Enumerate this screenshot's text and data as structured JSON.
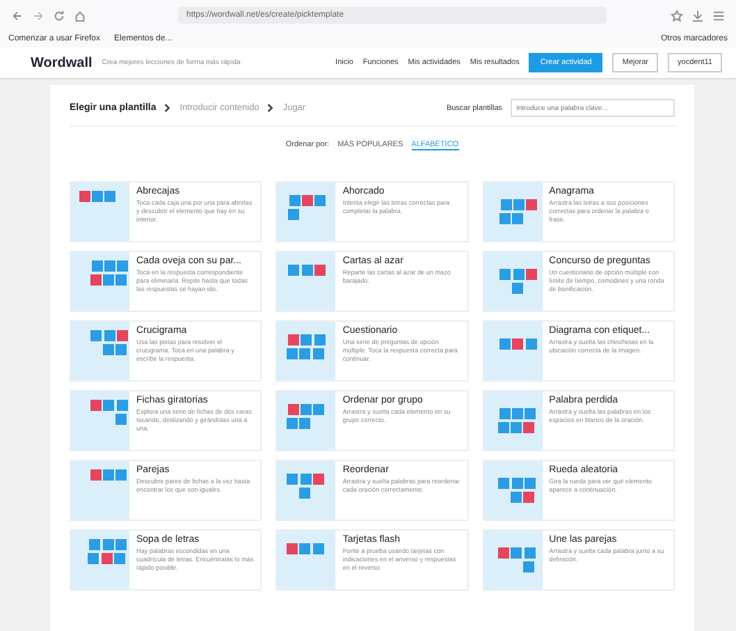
{
  "browser": {
    "address": "https://wordwall.net/es/create/picktemplate",
    "bookmarks": [
      "Comenzar a usar Firefox",
      "Elementos de..."
    ],
    "other_bookmarks": "Otros marcadores"
  },
  "header": {
    "logo": "Wordwall",
    "tagline": "Crea mejores lecciones de forma más rápida",
    "nav": [
      {
        "label": "Inicio"
      },
      {
        "label": "Funciones"
      },
      {
        "label": "Mis actividades"
      },
      {
        "label": "Mis resultados"
      }
    ],
    "create": "Crear actividad",
    "upgrade": "Mejorar",
    "user": "yocdent11"
  },
  "steps": [
    {
      "label": "Elegir una plantilla",
      "selected": true
    },
    {
      "label": "Introducir contenido",
      "selected": false
    },
    {
      "label": "Jugar",
      "selected": false
    }
  ],
  "search": {
    "label": "Buscar plantillas",
    "placeholder": "Introduce una palabra clave..."
  },
  "sort": {
    "label": "Ordenar por:",
    "options": [
      {
        "label": "MÁS POPULARES",
        "selected": false
      },
      {
        "label": "ALFABÉTICO",
        "selected": true
      }
    ]
  },
  "templates": [
    {
      "title": "Abrecajas",
      "description": "Toca cada caja una por una para abrirlas y descubrir el elemento que hay en su interior."
    },
    {
      "title": "Ahorcado",
      "description": "Intenta elegir las letras correctas para completar la palabra."
    },
    {
      "title": "Anagrama",
      "description": "Arrastra las letras a sus posiciones correctas para ordenar la palabra o frase."
    },
    {
      "title": "Cada oveja con su par...",
      "description": "Toca en la respuesta correspondiente para eliminarla. Repite hasta que todas las respuestas se hayan ido."
    },
    {
      "title": "Cartas al azar",
      "description": "Reparte las cartas al azar de un mazo barajado."
    },
    {
      "title": "Concurso de preguntas",
      "description": "Un cuestionario de opción múltiple con límite de tiempo, comodines y una ronda de bonificación."
    },
    {
      "title": "Crucigrama",
      "description": "Usa las pistas para resolver el crucigrama. Toca en una palabra y escribe la respuesta."
    },
    {
      "title": "Cuestionario",
      "description": "Una serie de preguntas de opción múltiple. Toca la respuesta correcta para continuar."
    },
    {
      "title": "Diagrama con etiquet...",
      "description": "Arrastra y suelta las chinchetas en la ubicación correcta de la imagen."
    },
    {
      "title": "Fichas giratorias",
      "description": "Explora una serie de fichas de dos caras tocando, deslizando y girándolas una a una."
    },
    {
      "title": "Ordenar por grupo",
      "description": "Arrastra y suelta cada elemento en su grupo correcto."
    },
    {
      "title": "Palabra perdida",
      "description": "Arrastra y suelta las palabras en los espacios en blanco de la oración."
    },
    {
      "title": "Parejas",
      "description": "Descubre pares de fichas a la vez hasta encontrar los que son iguales."
    },
    {
      "title": "Reordenar",
      "description": "Arrastra y suelta palabras para reordenar cada oración correctamente."
    },
    {
      "title": "Rueda aleatoria",
      "description": "Gira la rueda para ver qué elemento aparece a continuación."
    },
    {
      "title": "Sopa de letras",
      "description": "Hay palabras escondidas en una cuadrícula de letras. Encuéntralas lo más rápido posible."
    },
    {
      "title": "Tarjetas flash",
      "description": "Ponte a prueba usando tarjetas con indicaciones en el anverso y respuestas en el reverso."
    },
    {
      "title": "Une las parejas",
      "description": "Arrastra y suelta cada palabra junto a su definición."
    }
  ]
}
